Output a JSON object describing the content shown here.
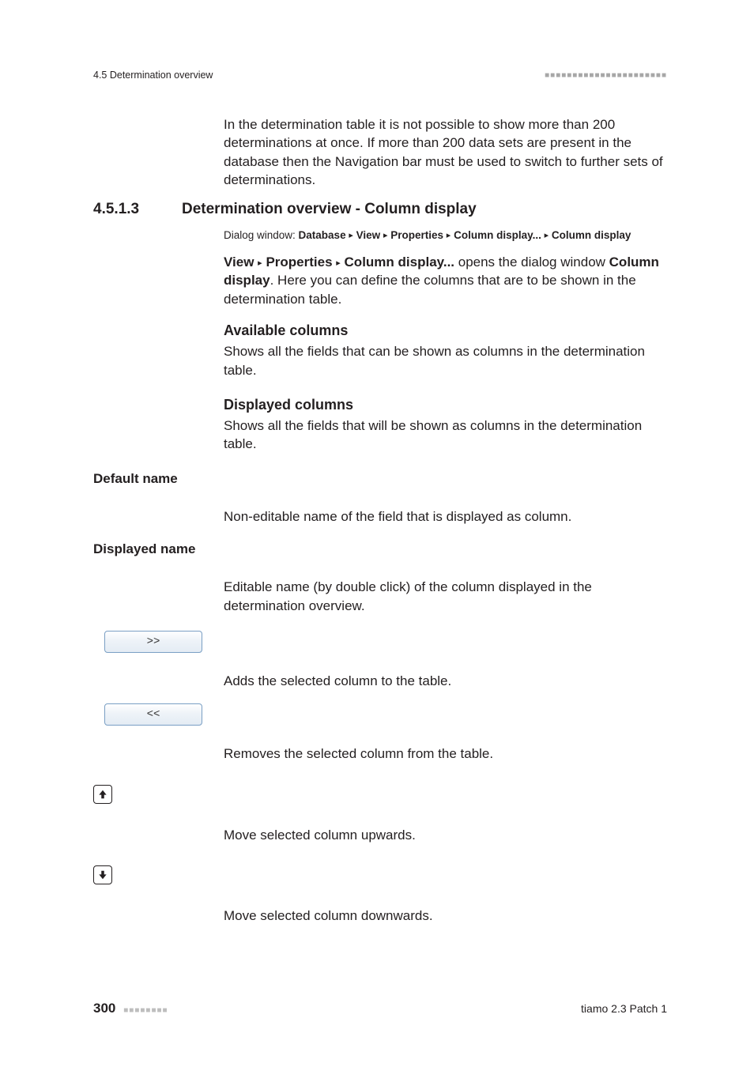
{
  "header": {
    "running_title": "4.5 Determination overview",
    "header_dots": "■■■■■■■■■■■■■■■■■■■■■■"
  },
  "intro_para": "In the determination table it is not possible to show more than 200 determinations at once. If more than 200 data sets are present in the database then the Navigation bar must be used to switch to further sets of determinations.",
  "section": {
    "number": "4.5.1.3",
    "title": "Determination overview - Column display"
  },
  "dialog_path": {
    "prefix": "Dialog window: ",
    "seg1": "Database",
    "seg2": "View",
    "seg3": "Properties",
    "seg4": "Column display...",
    "seg5": "Column display",
    "tri": "▸"
  },
  "open": {
    "seg_view": "View",
    "seg_props": "Properties",
    "seg_cd": "Column display...",
    "after": " opens the dialog window ",
    "bold_end": "Column display",
    "tail": ". Here you can define the columns that are to be shown in the determination table.",
    "tri": "▸"
  },
  "available": {
    "head": "Available columns",
    "body": "Shows all the fields that can be shown as columns in the determination table."
  },
  "displayed": {
    "head": "Displayed columns",
    "body": "Shows all the fields that will be shown as columns in the determination table."
  },
  "default_name": {
    "label": "Default name",
    "desc": "Non-editable name of the field that is displayed as column."
  },
  "displayed_name": {
    "label": "Displayed name",
    "desc": "Editable name (by double click) of the column displayed in the determination overview."
  },
  "btn_add": {
    "label": ">>",
    "desc": "Adds the selected column to the table."
  },
  "btn_remove": {
    "label": "<<",
    "desc": "Removes the selected column from the table."
  },
  "btn_up": {
    "desc": "Move selected column upwards."
  },
  "btn_down": {
    "desc": "Move selected column downwards."
  },
  "footer": {
    "page": "300",
    "footer_dots": "■■■■■■■■",
    "product": "tiamo 2.3 Patch 1"
  }
}
